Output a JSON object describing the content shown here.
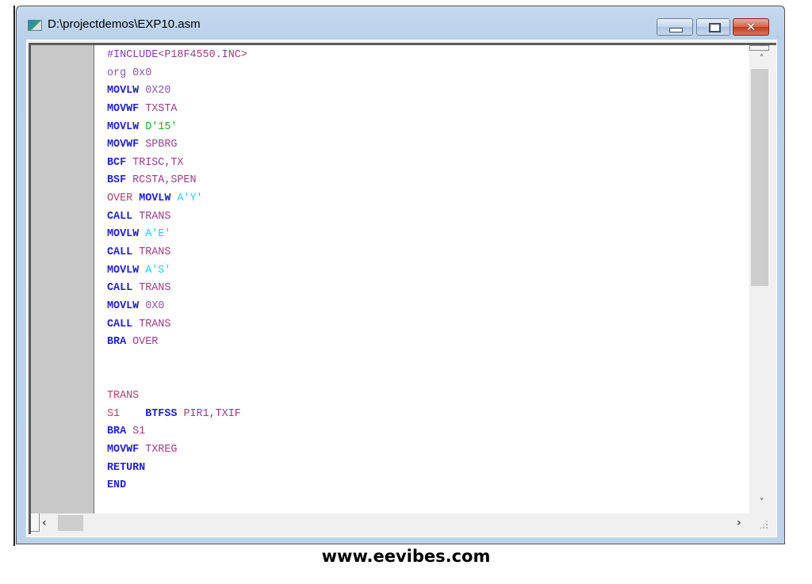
{
  "window": {
    "title": "D:\\projectdemos\\EXP10.asm",
    "controls": {
      "minimize": "—",
      "maximize": "□",
      "close": "✕"
    }
  },
  "editor": {
    "lines": [
      [
        {
          "t": "#INCLUDE",
          "c": "dir"
        },
        {
          "t": "<P18F4550.INC>",
          "c": "id"
        }
      ],
      [
        {
          "t": "org 0x0",
          "c": "num"
        }
      ],
      [
        {
          "t": "MOVLW",
          "c": "kw"
        },
        {
          "t": " 0X20",
          "c": "num"
        }
      ],
      [
        {
          "t": "MOVWF",
          "c": "kw"
        },
        {
          "t": " TXSTA",
          "c": "id"
        }
      ],
      [
        {
          "t": "MOVLW",
          "c": "kw"
        },
        {
          "t": " D'15'",
          "c": "dec"
        }
      ],
      [
        {
          "t": "MOVWF",
          "c": "kw"
        },
        {
          "t": " SPBRG",
          "c": "id"
        }
      ],
      [
        {
          "t": "BCF",
          "c": "kw"
        },
        {
          "t": " TRISC,TX",
          "c": "id"
        }
      ],
      [
        {
          "t": "BSF",
          "c": "kw"
        },
        {
          "t": " RCSTA,SPEN",
          "c": "id"
        }
      ],
      [
        {
          "t": "OVER ",
          "c": "lbl"
        },
        {
          "t": "MOVLW",
          "c": "kw"
        },
        {
          "t": " A'Y'",
          "c": "chr"
        }
      ],
      [
        {
          "t": "CALL",
          "c": "kw"
        },
        {
          "t": " TRANS",
          "c": "id"
        }
      ],
      [
        {
          "t": "MOVLW",
          "c": "kw"
        },
        {
          "t": " A'E'",
          "c": "chr"
        }
      ],
      [
        {
          "t": "CALL",
          "c": "kw"
        },
        {
          "t": " TRANS",
          "c": "id"
        }
      ],
      [
        {
          "t": "MOVLW",
          "c": "kw"
        },
        {
          "t": " A'S'",
          "c": "chr"
        }
      ],
      [
        {
          "t": "CALL",
          "c": "kw"
        },
        {
          "t": " TRANS",
          "c": "id"
        }
      ],
      [
        {
          "t": "MOVLW",
          "c": "kw"
        },
        {
          "t": " 0X0",
          "c": "num"
        }
      ],
      [
        {
          "t": "CALL",
          "c": "kw"
        },
        {
          "t": " TRANS",
          "c": "id"
        }
      ],
      [
        {
          "t": "BRA",
          "c": "kw"
        },
        {
          "t": " OVER",
          "c": "id"
        }
      ],
      [],
      [],
      [
        {
          "t": "TRANS",
          "c": "lbl"
        }
      ],
      [
        {
          "t": "S1    ",
          "c": "lbl"
        },
        {
          "t": "BTFSS",
          "c": "kw"
        },
        {
          "t": " PIR1,TXIF",
          "c": "id"
        }
      ],
      [
        {
          "t": "BRA",
          "c": "kw"
        },
        {
          "t": " S1",
          "c": "id"
        }
      ],
      [
        {
          "t": "MOVWF",
          "c": "kw"
        },
        {
          "t": " TXREG",
          "c": "id"
        }
      ],
      [
        {
          "t": "RETURN",
          "c": "kw"
        }
      ],
      [
        {
          "t": "END",
          "c": "kw"
        }
      ]
    ]
  },
  "scrollbars": {
    "up_arrow": "^",
    "down_arrow": "v",
    "left_arrow": "<",
    "right_arrow": ">"
  },
  "footer": {
    "text": "www.eevibes.com"
  }
}
